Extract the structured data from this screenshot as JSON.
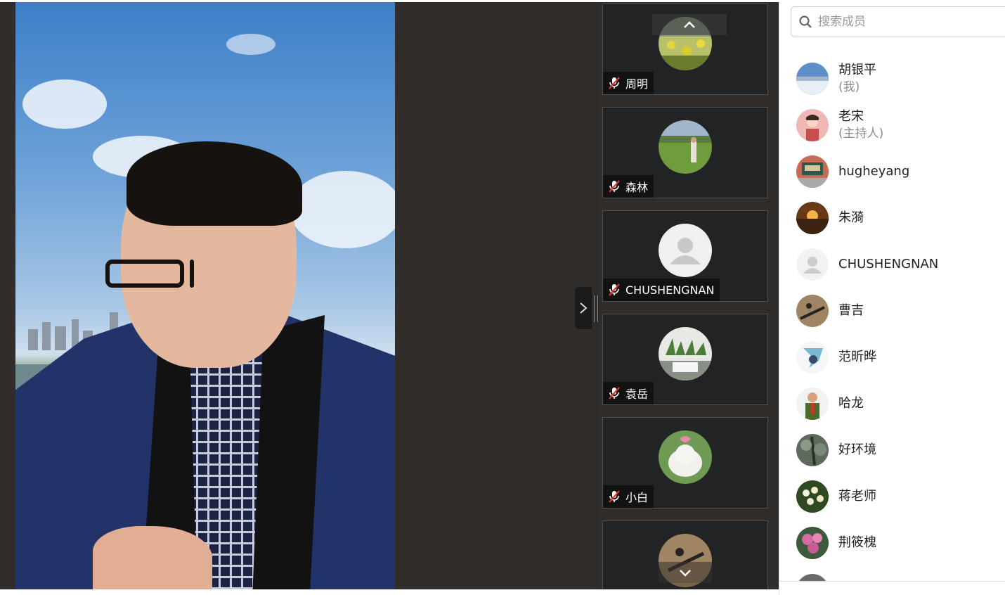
{
  "meeting": {
    "toggle_icon": "chevron-right-icon"
  },
  "thumbnails": {
    "scroll_up_icon": "chevron-up-icon",
    "scroll_down_icon": "chevron-down-icon",
    "tiles": [
      {
        "name": "周明",
        "muted": true
      },
      {
        "name": "森林",
        "muted": true
      },
      {
        "name": "CHUSHENGNAN",
        "muted": true
      },
      {
        "name": "袁岳",
        "muted": true
      },
      {
        "name": "小白",
        "muted": true
      },
      {
        "name": "",
        "muted": true
      }
    ]
  },
  "members": {
    "search_placeholder": "搜索成员",
    "list": [
      {
        "name": "胡银平",
        "role": "(我)"
      },
      {
        "name": "老宋",
        "role": "(主持人)"
      },
      {
        "name": "hugheyang",
        "role": ""
      },
      {
        "name": "朱漪",
        "role": ""
      },
      {
        "name": "CHUSHENGNAN",
        "role": ""
      },
      {
        "name": "曹吉",
        "role": ""
      },
      {
        "name": "范昕晔",
        "role": ""
      },
      {
        "name": "哈龙",
        "role": ""
      },
      {
        "name": "好环境",
        "role": ""
      },
      {
        "name": "蒋老师",
        "role": ""
      },
      {
        "name": "荆筱槐",
        "role": ""
      }
    ]
  }
}
